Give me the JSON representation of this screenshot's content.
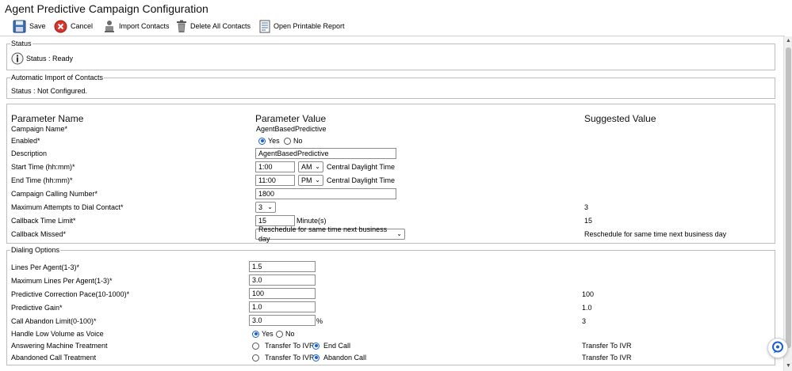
{
  "page": {
    "title": "Agent Predictive Campaign Configuration"
  },
  "toolbar": {
    "save": "Save",
    "cancel": "Cancel",
    "import_contacts": "Import Contacts",
    "delete_all_contacts": "Delete All Contacts",
    "open_printable_report": "Open Printable Report"
  },
  "status_section": {
    "legend": "Status",
    "text": "Status : Ready"
  },
  "auto_import": {
    "legend": "Automatic Import of Contacts",
    "text": "Status : Not Configured."
  },
  "params": {
    "headers": {
      "name": "Parameter Name",
      "value": "Parameter Value",
      "suggested": "Suggested Value"
    },
    "campaign_name": {
      "label": "Campaign Name*",
      "value": "AgentBasedPredictive"
    },
    "enabled": {
      "label": "Enabled*",
      "yes": "Yes",
      "no": "No",
      "selected": "Yes"
    },
    "description": {
      "label": "Description",
      "value": "AgentBasedPredictive"
    },
    "start_time": {
      "label": "Start Time (hh:mm)*",
      "value": "1:00",
      "ampm": "AM",
      "tz": "Central Daylight Time"
    },
    "end_time": {
      "label": "End Time (hh:mm)*",
      "value": "11:00",
      "ampm": "PM",
      "tz": "Central Daylight Time"
    },
    "calling_number": {
      "label": "Campaign Calling Number*",
      "value": "1800"
    },
    "max_attempts": {
      "label": "Maximum Attempts to Dial Contact*",
      "value": "3",
      "suggested": "3"
    },
    "callback_limit": {
      "label": "Callback Time Limit*",
      "value": "15",
      "unit": "Minute(s)",
      "suggested": "15"
    },
    "callback_missed": {
      "label": "Callback Missed*",
      "value": "Reschedule for same time next business day",
      "suggested": "Reschedule for same time next business day"
    }
  },
  "dialing": {
    "legend": "Dialing Options",
    "lines_per_agent": {
      "label": "Lines Per Agent(1-3)*",
      "value": "1.5"
    },
    "max_lines_per_agent": {
      "label": "Maximum Lines Per Agent(1-3)*",
      "value": "3.0"
    },
    "correction_pace": {
      "label": "Predictive Correction Pace(10-1000)*",
      "value": "100",
      "suggested": "100"
    },
    "predictive_gain": {
      "label": "Predictive Gain*",
      "value": "1.0",
      "suggested": "1.0"
    },
    "abandon_limit": {
      "label": "Call Abandon Limit(0-100)*",
      "value": "3.0",
      "unit": "%",
      "suggested": "3"
    },
    "low_volume": {
      "label": "Handle Low Volume as Voice",
      "yes": "Yes",
      "no": "No",
      "selected": "Yes"
    },
    "answering_machine": {
      "label": "Answering Machine Treatment",
      "opt1": "Transfer To IVR",
      "opt2": "End Call",
      "selected": "End Call",
      "suggested": "Transfer To IVR"
    },
    "abandoned_call": {
      "label": "Abandoned Call Treatment",
      "opt1": "Transfer To IVR",
      "opt2": "Abandon Call",
      "selected": "Abandon Call",
      "suggested": "Transfer To IVR"
    }
  },
  "colors": {
    "accent": "#1a5fd6",
    "cancel_red": "#d9342b",
    "border": "#bdbdbd"
  },
  "icons": [
    "save-icon",
    "cancel-icon",
    "import-contacts-icon",
    "trash-icon",
    "report-icon",
    "info-icon",
    "chat-icon"
  ]
}
